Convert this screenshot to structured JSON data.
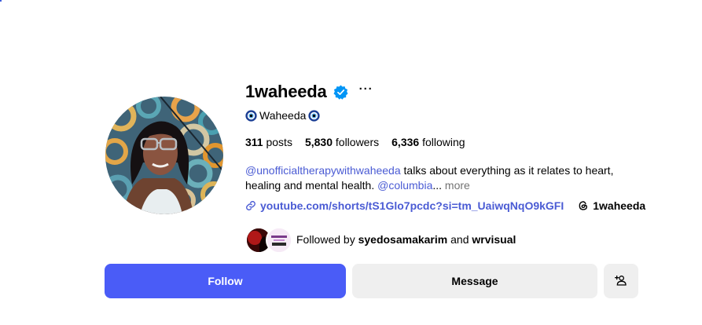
{
  "profile": {
    "username": "1waheeda",
    "full_name": "Waheeda",
    "stats": {
      "posts_count": "311",
      "posts_label": "posts",
      "followers_count": "5,830",
      "followers_label": "followers",
      "following_count": "6,336",
      "following_label": "following"
    },
    "bio": {
      "mention1": "@unofficialtherapywithwaheeda",
      "text1": " talks about everything as it relates to heart, healing and mental health. ",
      "mention2": "@columbia",
      "ellipsis": "...",
      "more": " more"
    },
    "link": "youtube.com/shorts/tS1Glo7pcdc?si=tm_UaiwqNqO9kGFI",
    "threads_handle": "1waheeda",
    "followed_by": {
      "prefix": "Followed by ",
      "user1": "syedosamakarim",
      "conjunction": " and ",
      "user2": "wrvisual"
    }
  },
  "buttons": {
    "follow": "Follow",
    "message": "Message",
    "more": "···"
  },
  "icons": {
    "verified": "verified-badge-icon",
    "evil_eye": "nazar-eye-icon",
    "link": "link-icon",
    "threads": "threads-icon",
    "add_person": "add-person-icon",
    "more": "more-dots-icon"
  },
  "colors": {
    "follow_button": "#4a5cf7",
    "link_blue": "#4a5bd4",
    "verified": "#0095f6",
    "secondary_button": "#efefef"
  }
}
